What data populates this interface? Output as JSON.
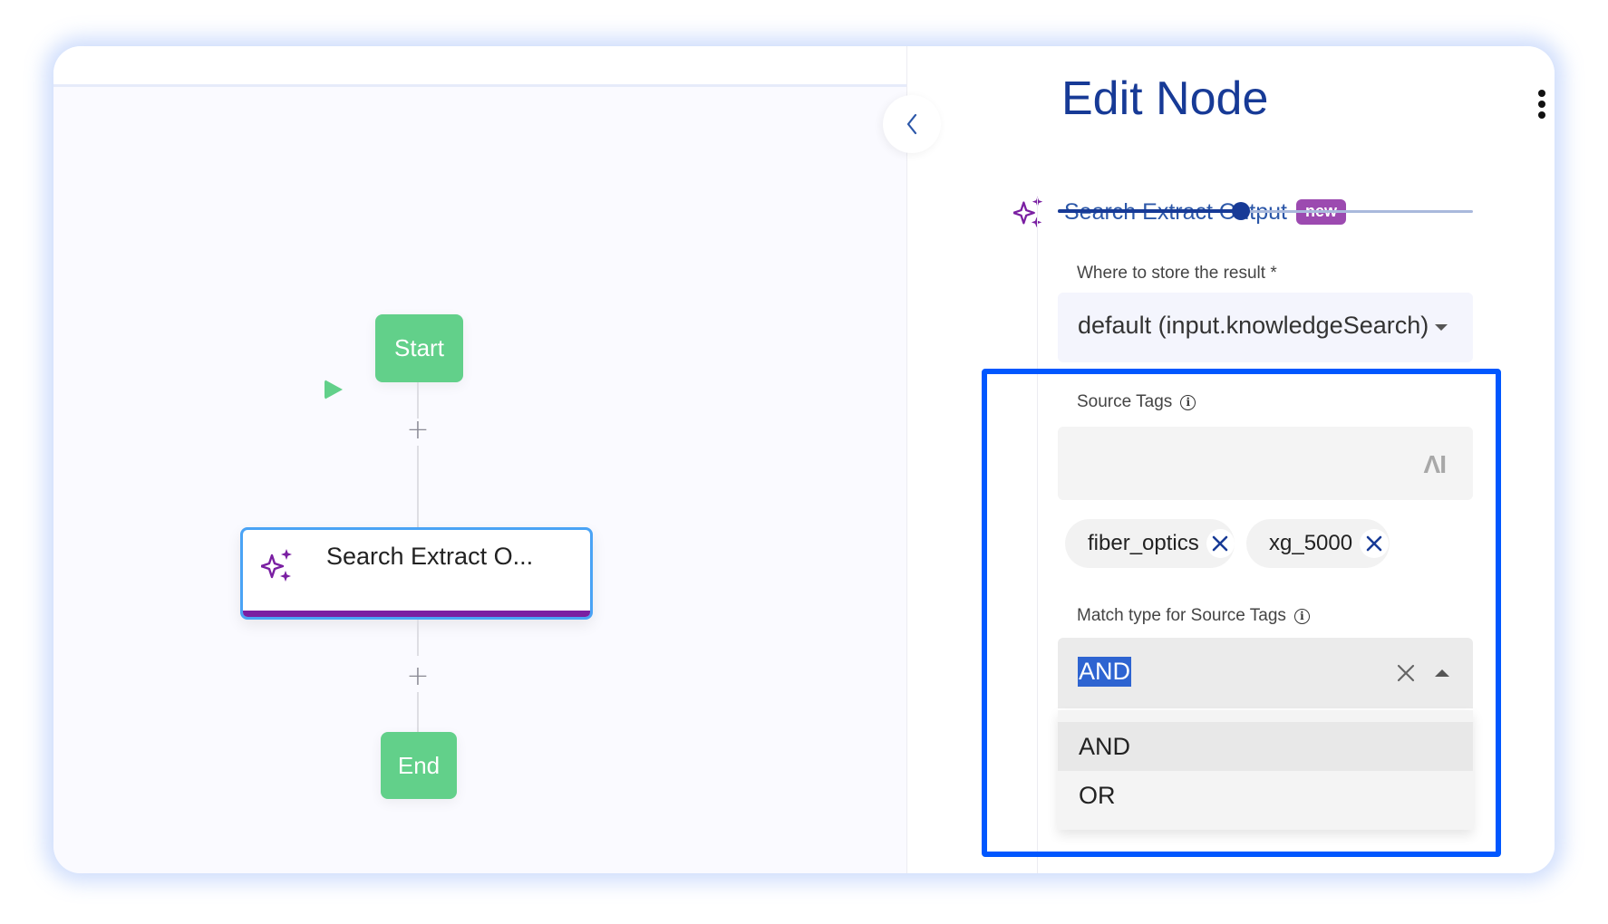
{
  "canvas": {
    "start_label": "Start",
    "task_node_label": "Search Extract O...",
    "end_label": "End",
    "add_step_symbol": "+"
  },
  "panel": {
    "title": "Edit Node",
    "node_type": "Search Extract Output",
    "badge": "new",
    "slider": {
      "value_fraction": 0.44
    },
    "store_result": {
      "label": "Where to store the result *",
      "value": "default (input.knowledgeSearch)"
    },
    "source_tags": {
      "label": "Source Tags",
      "input_value": "",
      "ai_icon_text": "ΛI",
      "chips": [
        "fiber_optics",
        "xg_5000"
      ]
    },
    "match_type": {
      "label": "Match type for Source Tags",
      "value": "AND",
      "options": [
        "AND",
        "OR"
      ],
      "highlighted_option": "AND"
    }
  },
  "colors": {
    "accent_navy": "#173a96",
    "node_green": "#62d08a",
    "badge_purple": "#9c4ab0",
    "sparkle_purple": "#7a1fa2",
    "highlight_blue": "#0057ff"
  }
}
